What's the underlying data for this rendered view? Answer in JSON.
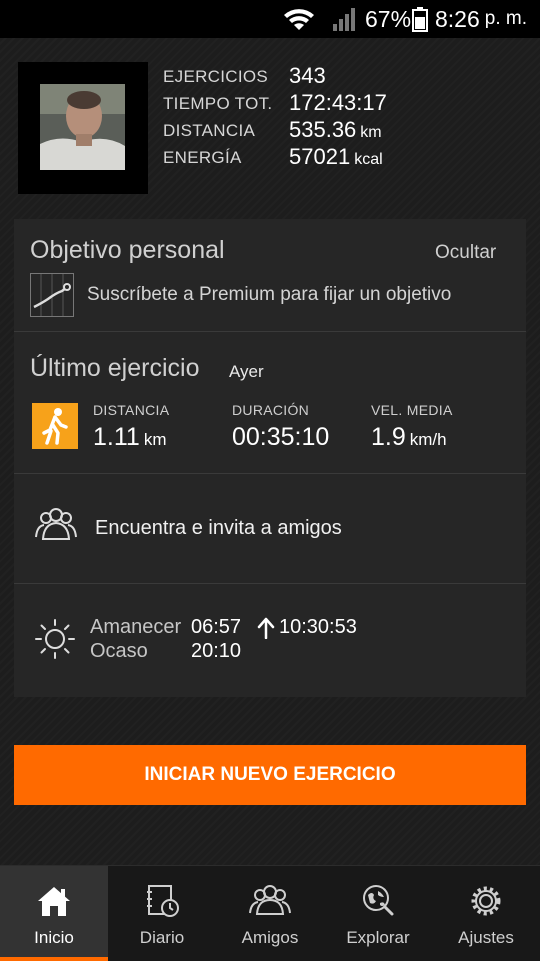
{
  "status_bar": {
    "battery": "67%",
    "time": "8:26",
    "ampm": "p. m."
  },
  "profile": {
    "stats": [
      {
        "label": "EJERCICIOS",
        "value": "343",
        "unit": ""
      },
      {
        "label": "TIEMPO TOT.",
        "value": "172:43:17",
        "unit": ""
      },
      {
        "label": "DISTANCIA",
        "value": "535.36",
        "unit": "km"
      },
      {
        "label": "ENERGÍA",
        "value": "57021",
        "unit": "kcal"
      }
    ]
  },
  "goal": {
    "title": "Objetivo personal",
    "hide_label": "Ocultar",
    "premium_text": "Suscríbete a Premium para fijar un objetivo"
  },
  "last_workout": {
    "title": "Último ejercicio",
    "when": "Ayer",
    "metrics": [
      {
        "label": "DISTANCIA",
        "value": "1.11",
        "unit": "km"
      },
      {
        "label": "DURACIÓN",
        "value": "00:35:10",
        "unit": ""
      },
      {
        "label": "VEL. MEDIA",
        "value": "1.9",
        "unit": "km/h"
      }
    ]
  },
  "friends": {
    "label": "Encuentra e invita a amigos"
  },
  "sun": {
    "sunrise_label": "Amanecer",
    "sunrise_time": "06:57",
    "sunset_label": "Ocaso",
    "sunset_time": "20:10",
    "daylight": "10:30:53"
  },
  "cta_label": "INICIAR NUEVO EJERCICIO",
  "tabs": [
    {
      "label": "Inicio",
      "icon": "home-icon",
      "active": true
    },
    {
      "label": "Diario",
      "icon": "diary-icon",
      "active": false
    },
    {
      "label": "Amigos",
      "icon": "friends-icon",
      "active": false
    },
    {
      "label": "Explorar",
      "icon": "explore-icon",
      "active": false
    },
    {
      "label": "Ajustes",
      "icon": "settings-icon",
      "active": false
    }
  ],
  "colors": {
    "accent": "#ff6a00",
    "background": "#1d1d1d",
    "card": "#262626"
  }
}
